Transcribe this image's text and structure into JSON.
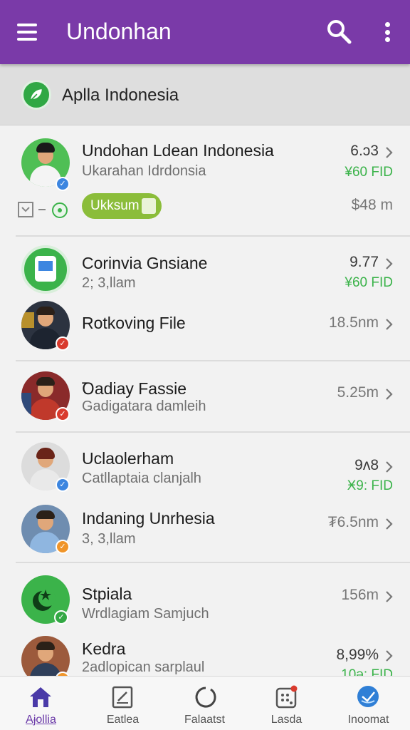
{
  "app": {
    "title": "Undonhan"
  },
  "section": {
    "label": "Aplla Indonesia"
  },
  "items": [
    {
      "name": "Undohan Ldean Indonesia",
      "sub": "Ukarahan Idrdonsia",
      "value": "6.ɔ3",
      "value2": "¥60 FID",
      "extra_value": "$48 m",
      "pill": "Ukksum",
      "badge_color": "#3d86e0"
    },
    {
      "name": "Corinvia Gnsiane",
      "sub": "2; 3,llam",
      "value": "9.77",
      "value2": "¥60 FID",
      "badge_color": "#33a844"
    },
    {
      "name": "Rotkoving File",
      "sub": "",
      "value": "18.5nm",
      "badge_color": "#d93b2e"
    },
    {
      "name": "Ꝺadiay Fassie",
      "sub": "Gadigatara damleih",
      "value": "5.25m",
      "badge_color": "#d93b2e"
    },
    {
      "name": "Uclaolerham",
      "sub": "Catllaptaia clanjalh",
      "value": "9ʌ8",
      "value2": "Ӿ9: FID",
      "badge_color": "#3d86e0"
    },
    {
      "name": "Indaning Unrhesia",
      "sub": "3, 3,llam",
      "value": "₮6.5nm",
      "badge_color": "#f0952a"
    },
    {
      "name": "Stpiala",
      "sub": "Wrdlagiam Samjuch",
      "value": "156m",
      "badge_color": "#33a844"
    },
    {
      "name": "Kedra",
      "sub": "2adlopican sarplaul",
      "value": "8,99%",
      "value2": "10ǝ: FID",
      "badge_color": "#f0952a"
    }
  ],
  "nav": [
    {
      "label": "Aɉollia",
      "icon": "home-icon"
    },
    {
      "label": "Eatlea",
      "icon": "edit-square-icon"
    },
    {
      "label": "Falaatst",
      "icon": "circle-icon"
    },
    {
      "label": "Lasda",
      "icon": "notification-grid-icon"
    },
    {
      "label": "Inoomat",
      "icon": "globe-badge-icon"
    }
  ],
  "colors": {
    "appbar": "#7a3aa8",
    "accent_green": "#3bb34a",
    "pill": "#8bbd3a",
    "active_nav": "#6b3aa8"
  }
}
